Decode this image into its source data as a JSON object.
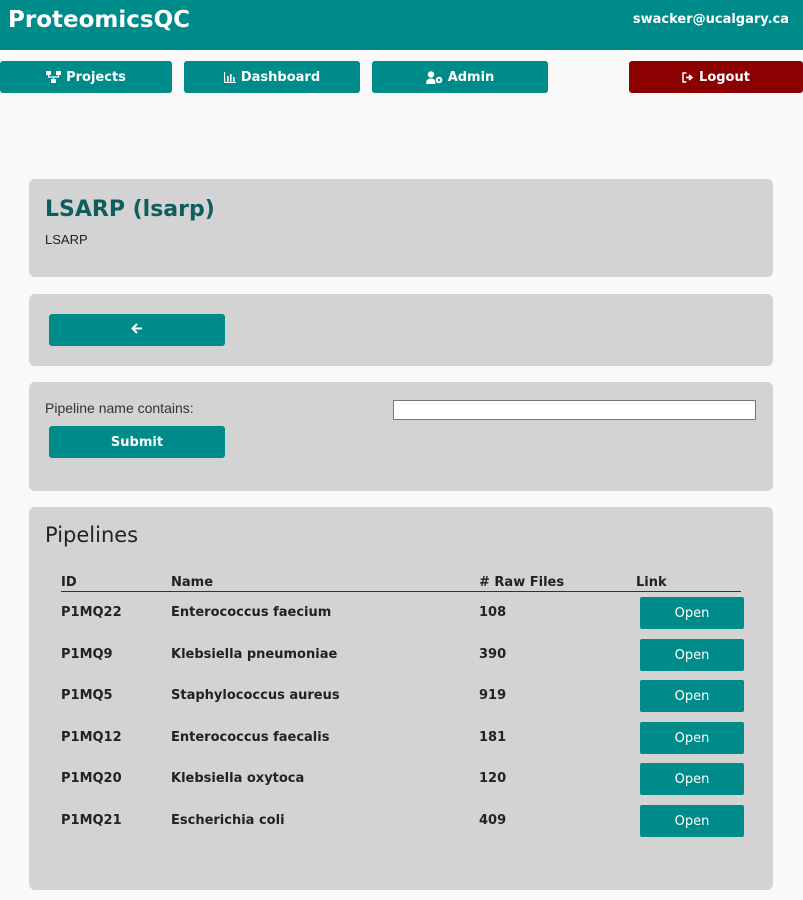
{
  "app": {
    "brand": "ProteomicsQC",
    "user_email": "swacker@ucalgary.ca"
  },
  "nav": {
    "projects": "Projects",
    "dashboard": "Dashboard",
    "admin": "Admin",
    "logout": "Logout"
  },
  "project": {
    "title": "LSARP (lsarp)",
    "subtitle": "LSARP"
  },
  "filter": {
    "label": "Pipeline name contains:",
    "value": "",
    "submit_label": "Submit"
  },
  "pipelines": {
    "title": "Pipelines",
    "columns": [
      "ID",
      "Name",
      "# Raw Files",
      "Link"
    ],
    "rows": [
      {
        "id": "P1MQ22",
        "name": "Enterococcus faecium",
        "raw_files": "108",
        "link": "Open"
      },
      {
        "id": "P1MQ9",
        "name": "Klebsiella pneumoniae",
        "raw_files": "390",
        "link": "Open"
      },
      {
        "id": "P1MQ5",
        "name": "Staphylococcus aureus",
        "raw_files": "919",
        "link": "Open"
      },
      {
        "id": "P1MQ12",
        "name": "Enterococcus faecalis",
        "raw_files": "181",
        "link": "Open"
      },
      {
        "id": "P1MQ20",
        "name": "Klebsiella oxytoca",
        "raw_files": "120",
        "link": "Open"
      },
      {
        "id": "P1MQ21",
        "name": "Escherichia coli",
        "raw_files": "409",
        "link": "Open"
      }
    ]
  },
  "icons": {
    "projects": "sitemap-icon",
    "dashboard": "bar-chart-icon",
    "admin": "user-cog-icon",
    "logout": "sign-out-icon",
    "back": "arrow-left-icon"
  },
  "colors": {
    "primary": "#008b8b",
    "danger": "#8b0000",
    "panel": "#d3d3d3",
    "title": "#0f5e5e"
  }
}
